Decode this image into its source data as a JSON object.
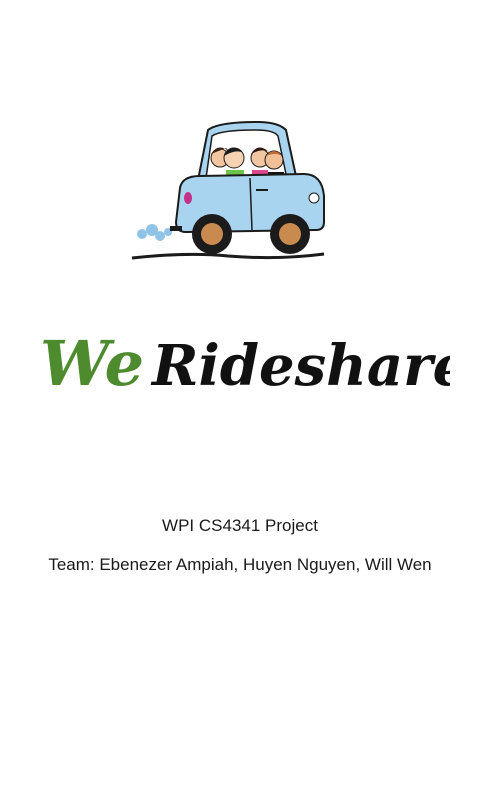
{
  "app": {
    "logo": {
      "part1": "We",
      "part2": "Rideshare"
    },
    "project_title": "WPI CS4341 Project",
    "team_line": "Team: Ebenezer Ampiah, Huyen Nguyen, Will Wen"
  },
  "colors": {
    "logo_green": "#4e8a2e",
    "logo_black": "#111111",
    "car_body": "#a9d4ef",
    "car_outline": "#1b1b1b",
    "wheel_hub": "#c98a4f",
    "exhaust": "#8fc4e8"
  },
  "icons": {
    "illustration": "car-with-passengers-icon"
  }
}
